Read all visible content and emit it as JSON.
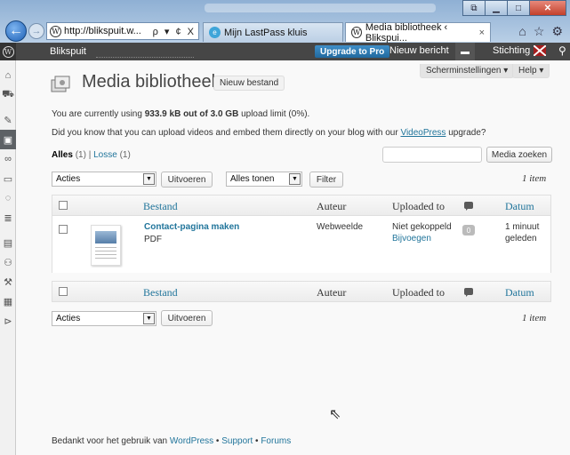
{
  "browser": {
    "address": "http://blikspuit.w...",
    "address_controls": "ρ ▾ ¢ X",
    "tabs": [
      {
        "label": "Mijn LastPass kluis"
      },
      {
        "label": "Media bibliotheek ‹ Blikspui..."
      }
    ],
    "tab_close": "×"
  },
  "adminbar": {
    "site": "Blikspuit",
    "upgrade": "Upgrade to Pro",
    "new_post": "Nieuw bericht",
    "user": "Stichting"
  },
  "header": {
    "screen_options": "Scherminstellingen ▾",
    "help": "Help ▾",
    "title": "Media bibliotheek",
    "add_new": "Nieuw bestand"
  },
  "notices": {
    "usage_pre": "You are currently using ",
    "usage_value": "933.9 kB out of 3.0 GB",
    "usage_post": " upload limit (0%).",
    "video_pre": "Did you know that you can upload videos and embed them directly on your blog with our ",
    "video_link": "VideoPress",
    "video_post": " upgrade?"
  },
  "filters": {
    "all_label": "Alles",
    "all_count": "(1)",
    "separator": "|",
    "loose_label": "Losse",
    "loose_count": "(1)",
    "search_button": "Media zoeken"
  },
  "bulk_top": {
    "action_select": "Acties",
    "apply": "Uitvoeren",
    "show_select": "Alles tonen",
    "filter": "Filter",
    "count": "1 item"
  },
  "table": {
    "columns": [
      "Bestand",
      "Auteur",
      "Uploaded to",
      "Datum"
    ],
    "rows": [
      {
        "title": "Contact-pagina maken",
        "type": "PDF",
        "author": "Webweelde",
        "uploaded_line1": "Niet gekoppeld",
        "uploaded_line2": "Bijvoegen",
        "comments": "0",
        "date_line1": "1 minuut",
        "date_line2": "geleden"
      }
    ]
  },
  "bulk_bottom": {
    "action_select": "Acties",
    "apply": "Uitvoeren",
    "count": "1 item"
  },
  "footer": {
    "pre": "Bedankt voor het gebruik van ",
    "wordpress": "WordPress",
    "sep1": " • ",
    "support": "Support",
    "sep2": " • ",
    "forums": "Forums"
  },
  "colors": {
    "link": "#21759b",
    "adminbar": "#464646",
    "upgrade": "#21699f"
  }
}
